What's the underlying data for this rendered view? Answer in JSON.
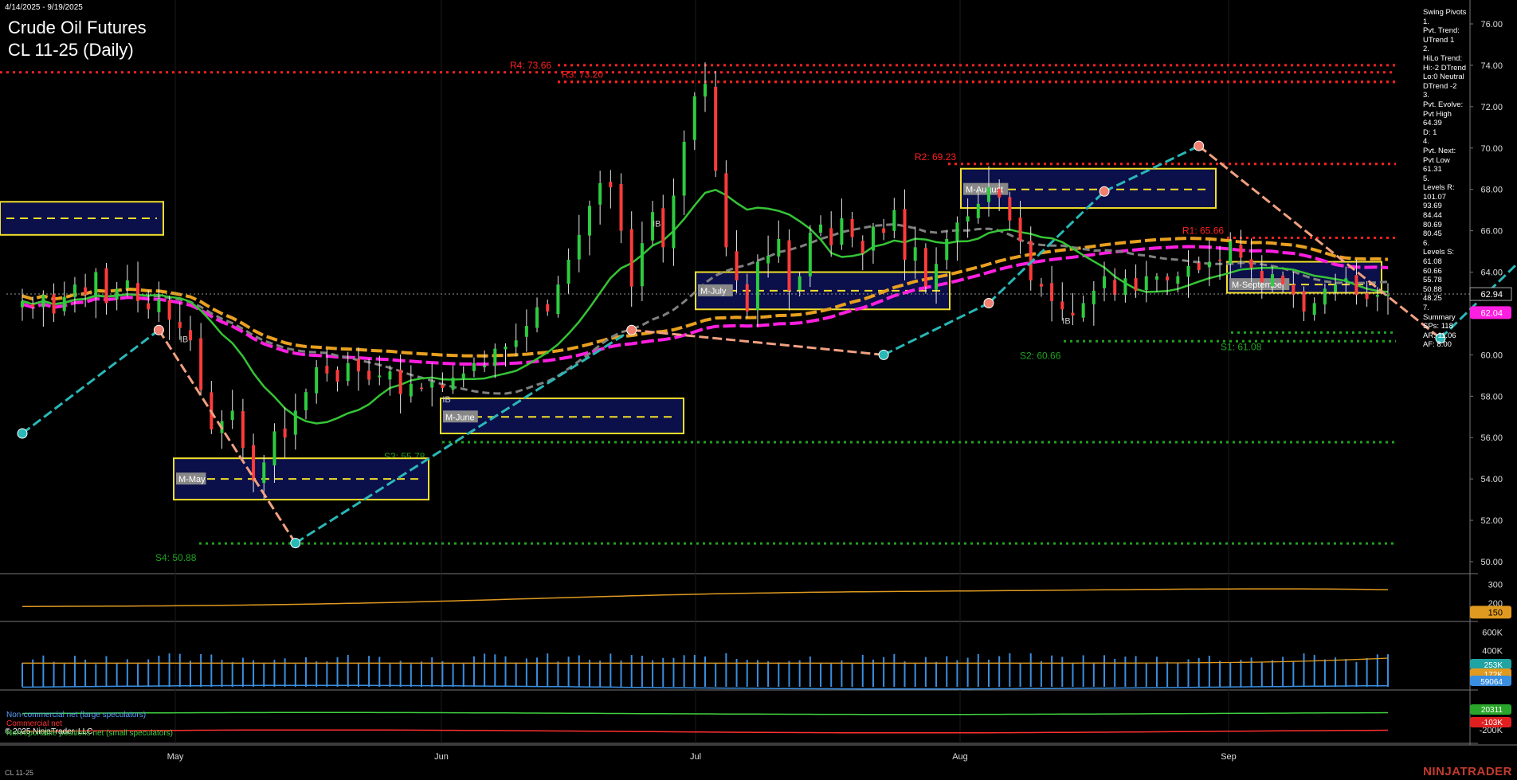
{
  "header": {
    "date_range": "4/14/2025 - 9/19/2025",
    "title": "Crude Oil Futures",
    "subtitle": "CL 11-25 (Daily)"
  },
  "side_panel": [
    "Swing Pivots",
    "1.",
    "Pvt. Trend:",
    "UTrend 1",
    "2.",
    "HiLo Trend:",
    "Hi:-2 DTrend",
    "Lo:0 Neutral",
    "DTrend -2",
    "3.",
    "Pvt. Evolve:",
    "Pvt High",
    "64.39",
    "D: 1",
    "4.",
    "Pvt. Next:",
    "Pvt Low",
    "61.31",
    "5.",
    "Levels R:",
    "101.07",
    "93.69",
    "84.44",
    "80.69",
    "80.45",
    "6.",
    "Levels S:",
    "61.08",
    "60.66",
    "55.78",
    "50.88",
    "48.25",
    "7.",
    "Summary",
    "SPs: 118",
    "AR: 11.06",
    "AF: 8.00"
  ],
  "footer": {
    "symbol": "CL 11-25",
    "brand": "NINJATRADER",
    "copyright": "© 2025 NinjaTrader, LLC"
  },
  "cot_legend": {
    "noncommercial": "Non-commercial net (large speculators)",
    "commercial": "Commercial net",
    "nonreportable": "Nonreportable positions net (small speculators)"
  },
  "colors": {
    "up_candle": "#2ecc40",
    "down_candle": "#ff3b3b",
    "resistance": "#ff2020",
    "support": "#1fa31f",
    "swing_up": "#2ab7b7",
    "swing_down": "#f0a080",
    "ma_orange": "#e8a020",
    "ma_magenta": "#ff1fe0",
    "ma_gray": "#808080",
    "ma_green": "#35c435"
  },
  "chart_data": [
    {
      "type": "candlestick",
      "title": "Crude Oil Futures",
      "x_tick_labels": [
        "May",
        "Jun",
        "Jul",
        "Aug",
        "Sep"
      ],
      "y_tick_labels": [
        "50.00",
        "52.00",
        "54.00",
        "56.00",
        "58.00",
        "60.00",
        "62.00",
        "64.00",
        "66.00",
        "68.00",
        "70.00",
        "72.00",
        "74.00",
        "76.00"
      ],
      "ylim": [
        49.2,
        77.2
      ],
      "last_price": "62.94",
      "ma_value_label": "62.04",
      "closes": [
        62.6,
        62.3,
        62.9,
        62.0,
        62.8,
        63.4,
        62.9,
        64.0,
        62.5,
        63.2,
        63.6,
        62.6,
        62.2,
        62.7,
        61.7,
        61.3,
        60.7,
        58.3,
        56.4,
        56.8,
        57.3,
        55.5,
        53.9,
        54.8,
        56.3,
        56.0,
        57.3,
        58.2,
        59.4,
        59.1,
        58.7,
        59.6,
        59.2,
        58.8,
        59.0,
        59.2,
        58.1,
        58.6,
        58.4,
        58.7,
        58.4,
        58.9,
        59.1,
        59.6,
        59.5,
        60.3,
        60.4,
        60.7,
        61.4,
        62.3,
        62.1,
        63.4,
        64.6,
        65.8,
        67.2,
        68.3,
        68.1,
        66.0,
        63.3,
        65.4,
        66.9,
        65.2,
        67.7,
        70.3,
        72.5,
        73.1,
        68.9,
        65.2,
        63.6,
        62.1,
        64.5,
        64.8,
        65.6,
        63.1,
        63.8,
        65.9,
        66.3,
        65.3,
        66.6,
        65.7,
        64.9,
        66.2,
        65.9,
        67.0,
        64.6,
        65.2,
        63.3,
        64.4,
        65.6,
        66.4,
        66.7,
        67.3,
        68.1,
        67.6,
        66.5,
        65.5,
        63.6,
        63.3,
        62.6,
        62.2,
        61.9,
        62.5,
        63.1,
        63.8,
        62.9,
        63.7,
        63.1,
        63.8,
        63.8,
        63.6,
        63.8,
        64.3,
        64.1,
        64.5,
        64.6,
        65.5,
        64.7,
        64.2,
        63.5,
        63.9,
        63.4,
        62.9,
        62.1,
        62.5,
        63.2,
        63.4,
        63.7,
        62.9,
        62.7,
        62.9,
        62.9
      ],
      "resistance_levels": [
        {
          "label": "R4: 73.66",
          "value": 73.66
        },
        {
          "label": "R3: 73.20",
          "value": 73.2
        },
        {
          "label": "R2: 69.23",
          "value": 69.23
        },
        {
          "label": "R1: 65.66",
          "value": 65.66
        }
      ],
      "support_levels": [
        {
          "label": "S1: 61.08",
          "value": 61.08
        },
        {
          "label": "S2: 60.66",
          "value": 60.66
        },
        {
          "label": "S3: 55.78",
          "value": 55.78
        },
        {
          "label": "S4: 50.88",
          "value": 50.88
        }
      ],
      "extra_dotted_levels": [
        74.0,
        73.2
      ],
      "swing_points": [
        {
          "i": 0,
          "v": 56.2
        },
        {
          "i": 13,
          "v": 61.2
        },
        {
          "i": 26,
          "v": 50.9
        },
        {
          "i": 58,
          "v": 61.2
        },
        {
          "i": 82,
          "v": 60.0
        },
        {
          "i": 92,
          "v": 62.5
        },
        {
          "i": 103,
          "v": 67.9
        },
        {
          "i": 112,
          "v": 70.1
        },
        {
          "i": 135,
          "v": 60.8
        },
        {
          "i": 151,
          "v": 68.7
        },
        {
          "i": 183,
          "v": 60.7
        },
        {
          "i": 206,
          "v": 65.6
        },
        {
          "i": 215,
          "v": 61.6
        },
        {
          "i": 228,
          "v": 64.3
        }
      ],
      "monthly_boxes": [
        {
          "label": "M-May",
          "low": 53.0,
          "high": 55.0,
          "mid": 54.0
        },
        {
          "label": "M-June",
          "low": 56.2,
          "high": 57.9,
          "mid": 57.0
        },
        {
          "label": "M-July",
          "low": 62.2,
          "high": 64.0,
          "mid": 63.1
        },
        {
          "label": "M-August",
          "low": 67.1,
          "high": 69.0,
          "mid": 68.0
        },
        {
          "label": "M-September",
          "low": 63.0,
          "high": 64.5,
          "mid": 63.4
        },
        {
          "label": "",
          "low": 65.8,
          "high": 67.4,
          "mid": 66.6
        }
      ],
      "ib_markers": [
        "IB"
      ]
    },
    {
      "type": "line",
      "name": "oscillator",
      "y_tick_labels": [
        "300",
        "200"
      ],
      "value_label": "150"
    },
    {
      "type": "bar",
      "name": "volume",
      "y_tick_labels": [
        "600K",
        "400K",
        "200K"
      ],
      "value_labels": [
        "253K",
        "172K",
        "59064"
      ]
    },
    {
      "type": "line",
      "name": "cot",
      "y_tick_labels": [
        "-200K"
      ],
      "value_labels": [
        "20311",
        "-103K"
      ]
    }
  ]
}
